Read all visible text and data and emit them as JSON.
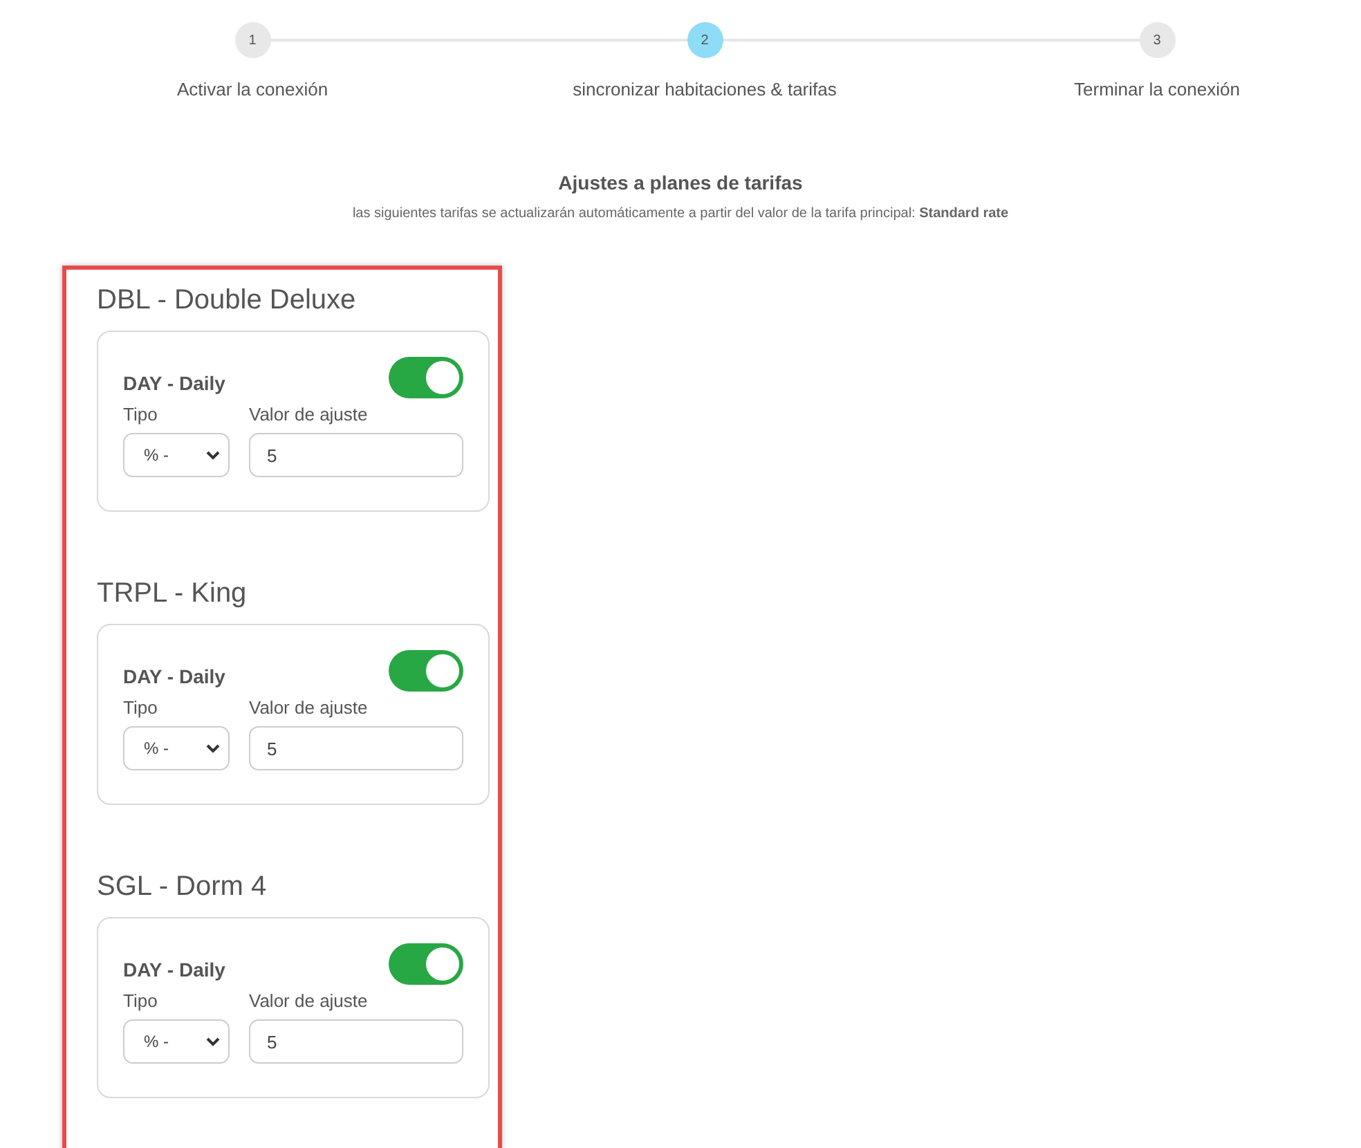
{
  "steps": [
    {
      "number": "1",
      "label": "Activar la conexión",
      "selected": false
    },
    {
      "number": "2",
      "label": "sincronizar habitaciones & tarifas",
      "selected": true
    },
    {
      "number": "3",
      "label": "Terminar la conexión",
      "selected": false
    }
  ],
  "title": "Ajustes a planes de tarifas",
  "subtitle": "las siguientes tarifas se actualizarán automáticamente a partir del valor de la tarifa principal: **Standard rate**",
  "rooms": [
    {
      "name": "DBL - Double Deluxe",
      "plan": "DAY - Daily",
      "on": true,
      "type_label": "Tipo",
      "type_value": "% -",
      "value_label": "Valor de ajuste",
      "value": "5"
    },
    {
      "name": "TRPL - King",
      "plan": "DAY - Daily",
      "on": true,
      "type_label": "Tipo",
      "type_value": "% -",
      "value_label": "Valor de ajuste",
      "value": "5"
    },
    {
      "name": "SGL - Dorm 4",
      "plan": "DAY - Daily",
      "on": true,
      "type_label": "Tipo",
      "type_value": "% -",
      "value_label": "Valor de ajuste",
      "value": "5"
    }
  ]
}
